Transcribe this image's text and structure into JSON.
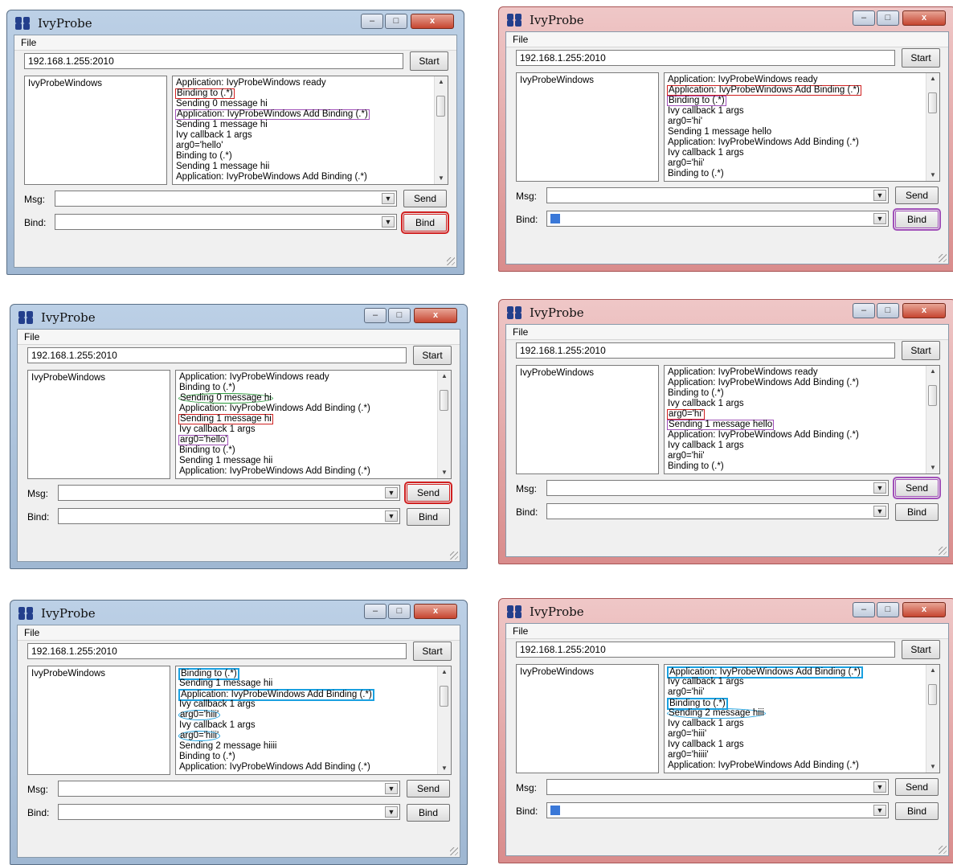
{
  "app_title": "IvyProbe",
  "menu_file": "File",
  "address": "192.168.1.255:2010",
  "buttons": {
    "start": "Start",
    "send": "Send",
    "bind": "Bind"
  },
  "labels": {
    "msg": "Msg:",
    "bind": "Bind:"
  },
  "client_item": "IvyProbeWindows",
  "window_controls": {
    "minimize": "–",
    "maximize": "□",
    "close": "x"
  },
  "panels": [
    {
      "theme": "blue",
      "highlight_button": "bind",
      "highlight_color": "red",
      "bind_selected": false,
      "log": [
        {
          "text": "Application: IvyProbeWindows ready",
          "hl": ""
        },
        {
          "text": "Binding to (.*)",
          "hl": "red"
        },
        {
          "text": "Sending 0 message hi",
          "hl": ""
        },
        {
          "text": "Application: IvyProbeWindows Add Binding (.*)",
          "hl": "purple"
        },
        {
          "text": "Sending 1 message hi",
          "hl": ""
        },
        {
          "text": "Ivy callback 1 args",
          "hl": ""
        },
        {
          "text": " arg0='hello'",
          "hl": ""
        },
        {
          "text": "Binding to (.*)",
          "hl": ""
        },
        {
          "text": "Sending 1 message hii",
          "hl": ""
        },
        {
          "text": "Application: IvyProbeWindows Add Binding (.*)",
          "hl": ""
        }
      ]
    },
    {
      "theme": "red",
      "highlight_button": "bind",
      "highlight_color": "purple",
      "bind_selected": true,
      "log": [
        {
          "text": "Application: IvyProbeWindows ready",
          "hl": ""
        },
        {
          "text": "Application: IvyProbeWindows Add Binding (.*)",
          "hl": "red"
        },
        {
          "text": "Binding to (.*)",
          "hl": "purple"
        },
        {
          "text": "Ivy callback 1 args",
          "hl": ""
        },
        {
          "text": " arg0='hi'",
          "hl": ""
        },
        {
          "text": "Sending 1 message hello",
          "hl": ""
        },
        {
          "text": "Application: IvyProbeWindows Add Binding (.*)",
          "hl": ""
        },
        {
          "text": "Ivy callback 1 args",
          "hl": ""
        },
        {
          "text": " arg0='hii'",
          "hl": ""
        },
        {
          "text": "Binding to (.*)",
          "hl": ""
        }
      ]
    },
    {
      "theme": "blue",
      "highlight_button": "send",
      "highlight_color": "red",
      "bind_selected": false,
      "log": [
        {
          "text": "Application: IvyProbeWindows ready",
          "hl": ""
        },
        {
          "text": "Binding to (.*)",
          "hl": ""
        },
        {
          "text": "Sending 0 message hi",
          "hl": "green"
        },
        {
          "text": "Application: IvyProbeWindows Add Binding (.*)",
          "hl": ""
        },
        {
          "text": "Sending 1 message hi",
          "hl": "red"
        },
        {
          "text": "Ivy callback 1 args",
          "hl": ""
        },
        {
          "text": " arg0='hello'",
          "hl": "purple"
        },
        {
          "text": "Binding to (.*)",
          "hl": ""
        },
        {
          "text": "Sending 1 message hii",
          "hl": ""
        },
        {
          "text": "Application: IvyProbeWindows Add Binding (.*)",
          "hl": ""
        }
      ]
    },
    {
      "theme": "red",
      "highlight_button": "send",
      "highlight_color": "purple",
      "bind_selected": false,
      "log": [
        {
          "text": "Application: IvyProbeWindows ready",
          "hl": ""
        },
        {
          "text": "Application: IvyProbeWindows Add Binding (.*)",
          "hl": ""
        },
        {
          "text": "Binding to (.*)",
          "hl": ""
        },
        {
          "text": "Ivy callback 1 args",
          "hl": ""
        },
        {
          "text": "arg0='hi'",
          "hl": "red"
        },
        {
          "text": "Sending 1 message hello",
          "hl": "purple"
        },
        {
          "text": "Application: IvyProbeWindows Add Binding (.*)",
          "hl": ""
        },
        {
          "text": "Ivy callback 1 args",
          "hl": ""
        },
        {
          "text": " arg0='hii'",
          "hl": ""
        },
        {
          "text": "Binding to (.*)",
          "hl": ""
        }
      ]
    },
    {
      "theme": "blue",
      "highlight_button": "",
      "highlight_color": "",
      "bind_selected": false,
      "log": [
        {
          "text": "Binding to (.*)",
          "hl": "blue"
        },
        {
          "text": "Sending 1 message hii",
          "hl": ""
        },
        {
          "text": "Application: IvyProbeWindows Add Binding (.*)",
          "hl": "blue"
        },
        {
          "text": "Ivy callback 1 args",
          "hl": ""
        },
        {
          "text": " arg0='hiii'",
          "hl": "blueoval"
        },
        {
          "text": "Ivy callback 1 args",
          "hl": ""
        },
        {
          "text": " arg0='hiii'",
          "hl": "blueoval"
        },
        {
          "text": "Sending 2 message hiiii",
          "hl": ""
        },
        {
          "text": "Binding to (.*)",
          "hl": ""
        },
        {
          "text": "Application: IvyProbeWindows Add Binding (.*)",
          "hl": ""
        }
      ]
    },
    {
      "theme": "red",
      "highlight_button": "",
      "highlight_color": "",
      "bind_selected": true,
      "log": [
        {
          "text": "Application: IvyProbeWindows Add Binding (.*)",
          "hl": "blue"
        },
        {
          "text": "Ivy callback 1 args",
          "hl": ""
        },
        {
          "text": " arg0='hii'",
          "hl": ""
        },
        {
          "text": "Binding to (.*)",
          "hl": "blue"
        },
        {
          "text": "Sending 2 message hiii",
          "hl": "blueoval"
        },
        {
          "text": "Ivy callback 1 args",
          "hl": ""
        },
        {
          "text": " arg0='hiii'",
          "hl": ""
        },
        {
          "text": "Ivy callback 1 args",
          "hl": ""
        },
        {
          "text": " arg0='hiiii'",
          "hl": ""
        },
        {
          "text": "Application: IvyProbeWindows Add Binding (.*)",
          "hl": ""
        }
      ]
    }
  ]
}
